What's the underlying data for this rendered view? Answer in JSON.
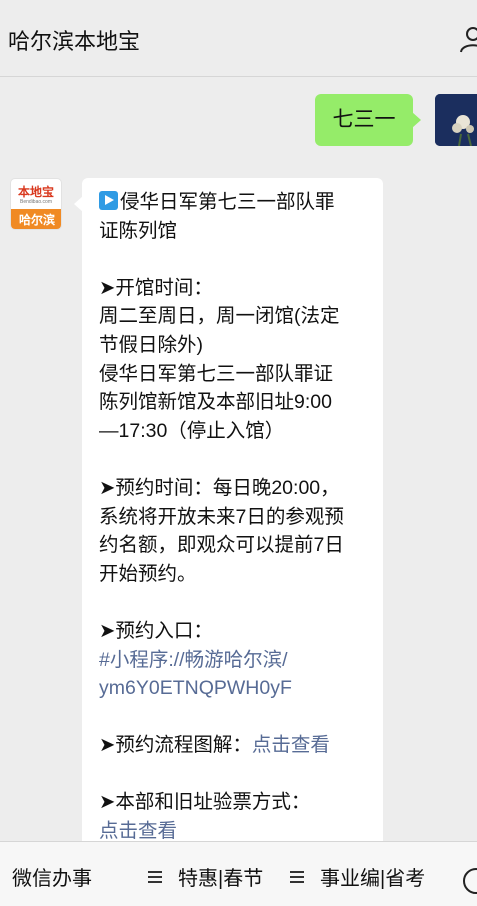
{
  "header": {
    "title": "哈尔滨本地宝"
  },
  "chat": {
    "user_message": "七三一",
    "account_logo": {
      "top": "本地宝",
      "sub": "Bendibao.com",
      "bottom": "哈尔滨"
    },
    "reply_lines": [
      {
        "text": "侵华日军第七三一部队罪",
        "icon": "play-icon"
      },
      {
        "text": "证陈列馆"
      },
      {
        "text": ""
      },
      {
        "text": "➤开馆时间："
      },
      {
        "text": "周二至周日，周一闭馆(法定"
      },
      {
        "text": "节假日除外)"
      },
      {
        "text": "侵华日军第七三一部队罪证"
      },
      {
        "text": "陈列馆新馆及本部旧址9:00"
      },
      {
        "text": "—17:30（停止入馆）"
      },
      {
        "text": ""
      },
      {
        "text": "➤预约时间：每日晚20:00，"
      },
      {
        "text": "系统将开放未来7日的参观预"
      },
      {
        "text": "约名额，即观众可以提前7日"
      },
      {
        "text": "开始预约。"
      },
      {
        "text": ""
      },
      {
        "text": "➤预约入口："
      },
      {
        "text": "#小程序://畅游哈尔滨/",
        "link": true
      },
      {
        "text": "ym6Y0ETNQPWH0yF",
        "link": true
      },
      {
        "text": ""
      },
      {
        "text": "➤预约流程图解：",
        "link_text": "点击查看"
      },
      {
        "text": ""
      },
      {
        "text": "➤本部和旧址验票方式："
      },
      {
        "text": "点击查看",
        "link": true
      }
    ]
  },
  "footer": {
    "tabs": [
      {
        "label": "微信办事",
        "has_menu_icon": false
      },
      {
        "label": "特惠|春节",
        "has_menu_icon": true
      },
      {
        "label": "事业编|省考",
        "has_menu_icon": true
      }
    ]
  }
}
